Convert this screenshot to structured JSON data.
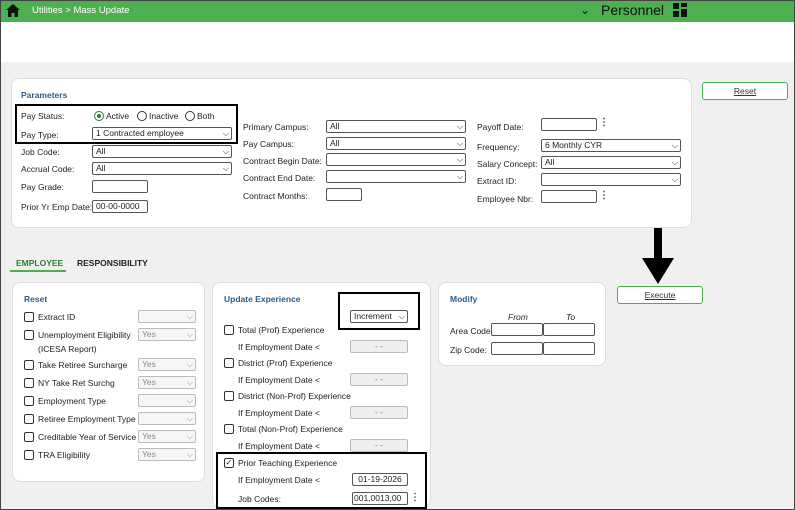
{
  "header": {
    "breadcrumb": "Utilities > Mass Update",
    "app_name": "Personnel"
  },
  "buttons": {
    "reset": "Reset",
    "execute": "Execute"
  },
  "parameters": {
    "title": "Parameters",
    "pay_status_label": "Pay Status:",
    "pay_status_options": [
      "Active",
      "Inactive",
      "Both"
    ],
    "pay_status_selected": "Active",
    "pay_type_label": "Pay Type:",
    "pay_type_value": "1 Contracted employee",
    "job_code_label": "Job Code:",
    "job_code_value": "All",
    "accrual_code_label": "Accrual Code:",
    "accrual_code_value": "All",
    "pay_grade_label": "Pay Grade:",
    "pay_grade_value": "",
    "prior_yr_label": "Prior Yr Emp Date:",
    "prior_yr_value": "00-00-0000",
    "primary_campus_label": "Primary Campus:",
    "primary_campus_value": "All",
    "pay_campus_label": "Pay Campus:",
    "pay_campus_value": "All",
    "contract_begin_label": "Contract Begin Date:",
    "contract_end_label": "Contract End Date:",
    "contract_months_label": "Contract Months:",
    "payoff_date_label": "Payoff Date:",
    "frequency_label": "Frequency:",
    "frequency_value": "6 Monthly CYR",
    "salary_concept_label": "Salary Concept:",
    "salary_concept_value": "All",
    "extract_id_label": "Extract ID:",
    "employee_nbr_label": "Employee Nbr:"
  },
  "tabs": [
    "EMPLOYEE",
    "RESPONSIBILITY"
  ],
  "reset_panel": {
    "title": "Reset",
    "items": [
      {
        "label": "Extract ID",
        "value": ""
      },
      {
        "label": "Unemployment Eligibility",
        "sub": "(ICESA Report)",
        "value": "Yes"
      },
      {
        "label": "Take Retiree Surcharge",
        "value": "Yes"
      },
      {
        "label": "NY Take Ret Surchg",
        "value": "Yes"
      },
      {
        "label": "Employment Type",
        "value": ""
      },
      {
        "label": "Retiree Employment Type",
        "value": ""
      },
      {
        "label": "Creditable Year of Service",
        "value": "Yes"
      },
      {
        "label": "TRA Eligibility",
        "value": "Yes"
      }
    ]
  },
  "update_panel": {
    "title": "Update Experience",
    "mode": "Increment",
    "items": [
      "Total (Prof) Experience",
      "District (Prof) Experience",
      "District (Non-Prof) Experience",
      "Total (Non-Prof) Experience"
    ],
    "date_label": "If Employment Date <",
    "date_placeholder": "- -",
    "prior": {
      "label": "Prior Teaching Experience",
      "date_value": "01-19-2026",
      "job_codes_label": "Job Codes:",
      "job_codes_value": "001,0013,00"
    }
  },
  "modify_panel": {
    "title": "Modify",
    "from": "From",
    "to": "To",
    "area_code_label": "Area Code:",
    "zip_code_label": "Zip Code:"
  }
}
